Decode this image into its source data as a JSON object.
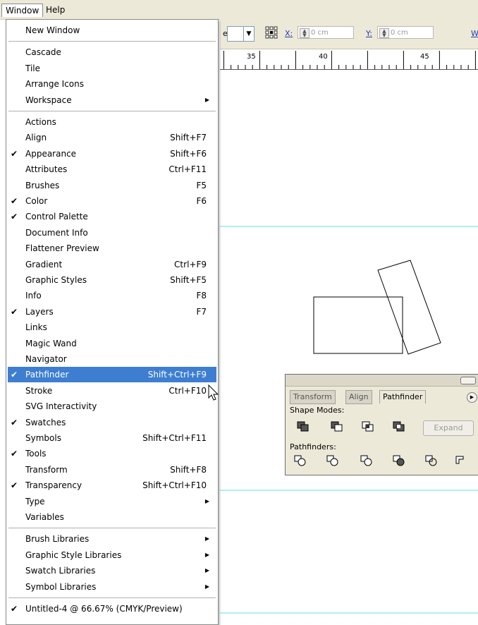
{
  "menubar": {
    "items": [
      "Window",
      "Help"
    ]
  },
  "control_bar": {
    "fragment": "e:",
    "x_label": "X:",
    "x_value": "0 cm",
    "y_label": "Y:",
    "y_value": "0 cm",
    "w_label": "W"
  },
  "ruler": {
    "labels": [
      "35",
      "40",
      "45"
    ]
  },
  "window_menu": {
    "items": [
      {
        "label": "New Window",
        "shortcut": "",
        "checked": false,
        "submenu": false
      },
      {
        "label": "Cascade",
        "shortcut": "",
        "checked": false,
        "submenu": false
      },
      {
        "label": "Tile",
        "shortcut": "",
        "checked": false,
        "submenu": false
      },
      {
        "label": "Arrange Icons",
        "shortcut": "",
        "checked": false,
        "submenu": false
      },
      {
        "label": "Workspace",
        "shortcut": "",
        "checked": false,
        "submenu": true
      },
      {
        "label": "Actions",
        "shortcut": "",
        "checked": false,
        "submenu": false
      },
      {
        "label": "Align",
        "shortcut": "Shift+F7",
        "checked": false,
        "submenu": false
      },
      {
        "label": "Appearance",
        "shortcut": "Shift+F6",
        "checked": true,
        "submenu": false
      },
      {
        "label": "Attributes",
        "shortcut": "Ctrl+F11",
        "checked": false,
        "submenu": false
      },
      {
        "label": "Brushes",
        "shortcut": "F5",
        "checked": false,
        "submenu": false
      },
      {
        "label": "Color",
        "shortcut": "F6",
        "checked": true,
        "submenu": false
      },
      {
        "label": "Control Palette",
        "shortcut": "",
        "checked": true,
        "submenu": false
      },
      {
        "label": "Document Info",
        "shortcut": "",
        "checked": false,
        "submenu": false
      },
      {
        "label": "Flattener Preview",
        "shortcut": "",
        "checked": false,
        "submenu": false
      },
      {
        "label": "Gradient",
        "shortcut": "Ctrl+F9",
        "checked": false,
        "submenu": false
      },
      {
        "label": "Graphic Styles",
        "shortcut": "Shift+F5",
        "checked": false,
        "submenu": false
      },
      {
        "label": "Info",
        "shortcut": "F8",
        "checked": false,
        "submenu": false
      },
      {
        "label": "Layers",
        "shortcut": "F7",
        "checked": true,
        "submenu": false
      },
      {
        "label": "Links",
        "shortcut": "",
        "checked": false,
        "submenu": false
      },
      {
        "label": "Magic Wand",
        "shortcut": "",
        "checked": false,
        "submenu": false
      },
      {
        "label": "Navigator",
        "shortcut": "",
        "checked": false,
        "submenu": false
      },
      {
        "label": "Pathfinder",
        "shortcut": "Shift+Ctrl+F9",
        "checked": true,
        "submenu": false,
        "highlighted": true
      },
      {
        "label": "Stroke",
        "shortcut": "Ctrl+F10",
        "checked": false,
        "submenu": false
      },
      {
        "label": "SVG Interactivity",
        "shortcut": "",
        "checked": false,
        "submenu": false
      },
      {
        "label": "Swatches",
        "shortcut": "",
        "checked": true,
        "submenu": false
      },
      {
        "label": "Symbols",
        "shortcut": "Shift+Ctrl+F11",
        "checked": false,
        "submenu": false
      },
      {
        "label": "Tools",
        "shortcut": "",
        "checked": true,
        "submenu": false
      },
      {
        "label": "Transform",
        "shortcut": "Shift+F8",
        "checked": false,
        "submenu": false
      },
      {
        "label": "Transparency",
        "shortcut": "Shift+Ctrl+F10",
        "checked": true,
        "submenu": false
      },
      {
        "label": "Type",
        "shortcut": "",
        "checked": false,
        "submenu": true
      },
      {
        "label": "Variables",
        "shortcut": "",
        "checked": false,
        "submenu": false
      },
      {
        "label": "Brush Libraries",
        "shortcut": "",
        "checked": false,
        "submenu": true
      },
      {
        "label": "Graphic Style Libraries",
        "shortcut": "",
        "checked": false,
        "submenu": true
      },
      {
        "label": "Swatch Libraries",
        "shortcut": "",
        "checked": false,
        "submenu": true
      },
      {
        "label": "Symbol Libraries",
        "shortcut": "",
        "checked": false,
        "submenu": true
      },
      {
        "label": "Untitled-4 @ 66.67% (CMYK/Preview)",
        "shortcut": "",
        "checked": true,
        "submenu": false
      }
    ]
  },
  "pathfinder_panel": {
    "tabs": [
      "Transform",
      "Align",
      "Pathfinder"
    ],
    "active_tab": "Pathfinder",
    "shape_modes_label": "Shape Modes:",
    "pathfinders_label": "Pathfinders:",
    "expand_label": "Expand",
    "shape_mode_icons": [
      "add-to-shape-area-icon",
      "subtract-from-shape-area-icon",
      "intersect-shape-areas-icon",
      "exclude-overlapping-shape-areas-icon"
    ],
    "pathfinder_icons": [
      "divide-icon",
      "trim-icon",
      "merge-icon",
      "crop-icon",
      "outline-icon",
      "minus-back-icon"
    ]
  },
  "colors": {
    "highlight": "#3d7ed1",
    "guide": "#5de0e6",
    "chrome": "#ece9d8",
    "link": "#1c3fb6"
  }
}
